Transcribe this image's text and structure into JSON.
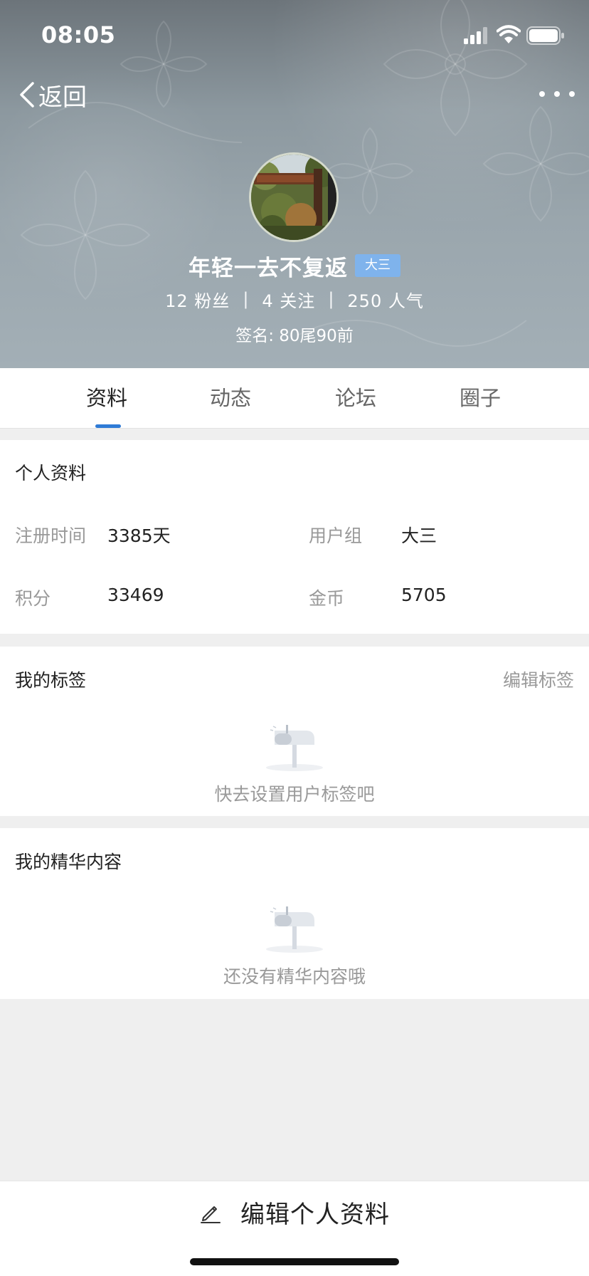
{
  "status_bar": {
    "time": "08:05"
  },
  "nav": {
    "back_label": "返回"
  },
  "profile": {
    "name": "年轻一去不复返",
    "level_badge": "大三",
    "stats": {
      "fans": "12 粉丝",
      "following": "4 关注",
      "popularity": "250 人气",
      "separator": "|"
    },
    "signature": "签名: 80尾90前"
  },
  "tabs": [
    {
      "label": "资料",
      "active": true
    },
    {
      "label": "动态",
      "active": false
    },
    {
      "label": "论坛",
      "active": false
    },
    {
      "label": "圈子",
      "active": false
    }
  ],
  "personal_info": {
    "title": "个人资料",
    "fields": [
      {
        "label": "注册时间",
        "value": "3385天"
      },
      {
        "label": "用户组",
        "value": "大三"
      },
      {
        "label": "积分",
        "value": "33469"
      },
      {
        "label": "金币",
        "value": "5705"
      }
    ]
  },
  "tags_section": {
    "title": "我的标签",
    "edit_label": "编辑标签",
    "empty_text": "快去设置用户标签吧",
    "empty_icon": "mailbox-icon"
  },
  "featured_section": {
    "title": "我的精华内容",
    "empty_text": "还没有精华内容哦",
    "empty_icon": "mailbox-icon"
  },
  "bottom_bar": {
    "edit_profile_label": "编辑个人资料",
    "icon": "pencil-icon"
  },
  "colors": {
    "accent": "#2f7bd6",
    "badge": "#7fb3ec",
    "header_bg": "#8c989f",
    "page_bg": "#efefef"
  }
}
